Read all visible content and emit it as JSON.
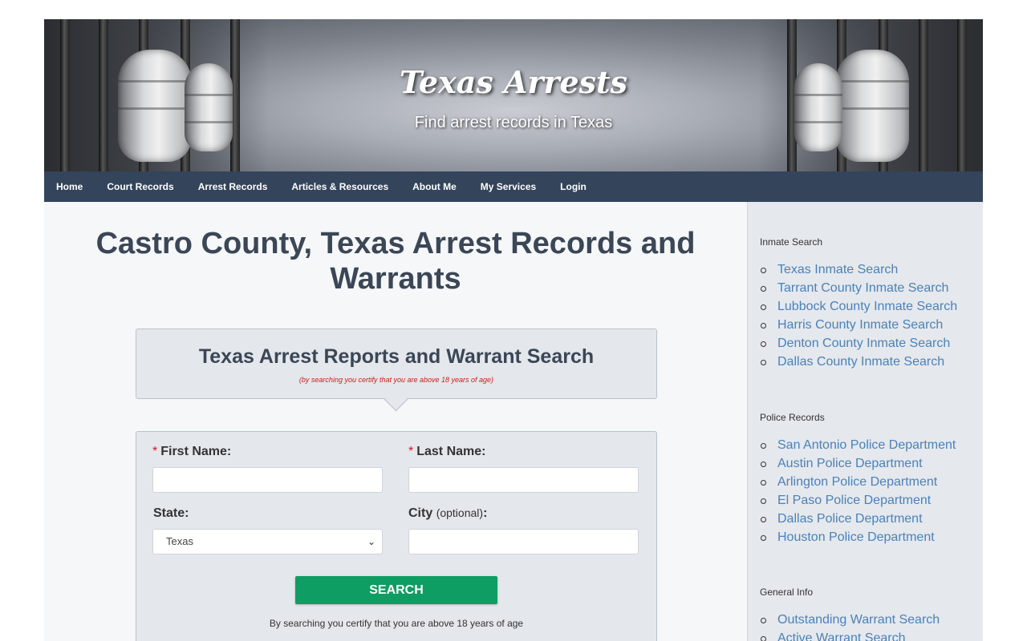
{
  "header": {
    "site_title": "Texas Arrests",
    "tagline": "Find arrest records in Texas"
  },
  "nav": {
    "items": [
      {
        "label": "Home"
      },
      {
        "label": "Court Records"
      },
      {
        "label": "Arrest Records"
      },
      {
        "label": "Articles & Resources"
      },
      {
        "label": "About Me"
      },
      {
        "label": "My Services"
      },
      {
        "label": "Login"
      }
    ]
  },
  "main": {
    "page_title": "Castro County, Texas Arrest Records and Warrants",
    "search_title": "Texas Arrest Reports and Warrant Search",
    "age_note": "(by searching you certify that you are above 18 years of age)",
    "form": {
      "required_mark": "*",
      "first_name_label": "First Name:",
      "last_name_label": "Last Name:",
      "state_label": "State:",
      "state_value": "Texas",
      "city_label": "City",
      "city_optional": "(optional)",
      "city_colon": ":",
      "search_button": "SEARCH",
      "certify_text": "By searching you certify that you are above 18 years of age"
    }
  },
  "sidebar": {
    "inmate": {
      "title": "Inmate Search",
      "links": [
        "Texas Inmate Search",
        "Tarrant County Inmate Search",
        "Lubbock County Inmate Search",
        "Harris County Inmate Search",
        "Denton County Inmate Search",
        "Dallas County Inmate Search"
      ]
    },
    "police": {
      "title": "Police Records",
      "links": [
        "San Antonio Police Department",
        "Austin Police Department",
        "Arlington Police Department",
        "El Paso Police Department",
        "Dallas Police Department",
        "Houston Police Department"
      ]
    },
    "general": {
      "title": "General Info",
      "links": [
        "Outstanding Warrant Search",
        "Active Warrant Search"
      ]
    }
  },
  "colors": {
    "nav_bg": "#33445b",
    "title_text": "#3b4656",
    "link": "#4a82b8",
    "search_button": "#0e9d62",
    "required": "#d11a1a"
  },
  "icons": {
    "select_arrow": "chevron-down-icon"
  }
}
